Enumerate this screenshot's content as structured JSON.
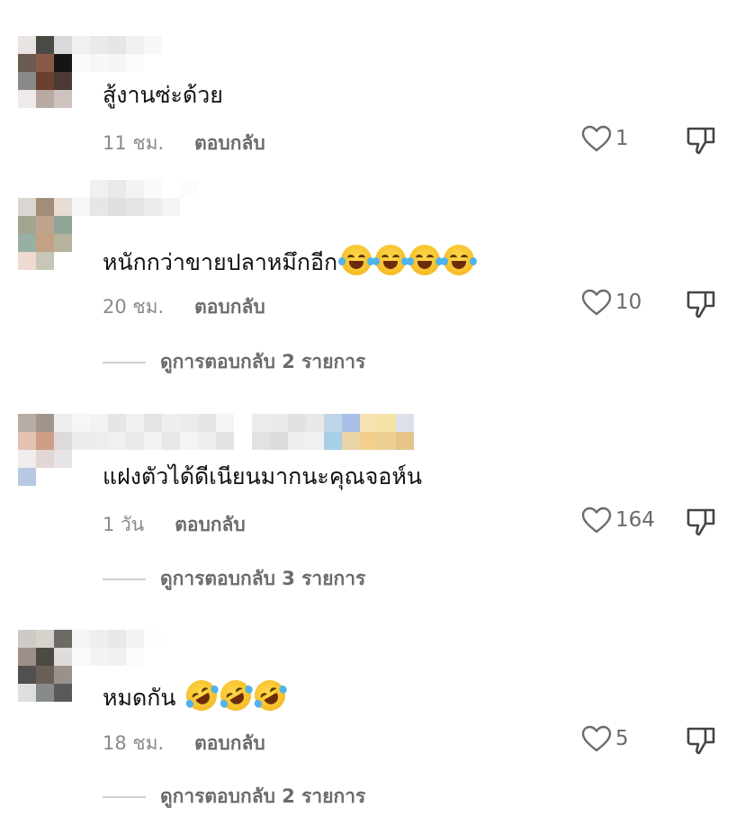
{
  "comments": [
    {
      "text": "สู้งานซ่ะด้วย",
      "time": "11 ชม.",
      "reply_label": "ตอบกลับ",
      "likes": "1",
      "emoji_count": 0,
      "view_replies": ""
    },
    {
      "text": "หนักกว่าขายปลาหมึกอีก",
      "time": "20 ชม.",
      "reply_label": "ตอบกลับ",
      "likes": "10",
      "emoji": "face-with-tears-of-joy",
      "emoji_count": 4,
      "view_replies": "ดูการตอบกลับ 2 รายการ"
    },
    {
      "text": "แฝงตัวได้ดีเนียนมากนะคุณจอห์น",
      "time": "1 วัน",
      "reply_label": "ตอบกลับ",
      "likes": "164",
      "emoji_count": 0,
      "view_replies": "ดูการตอบกลับ 3 รายการ"
    },
    {
      "text": "หมดกัน",
      "time": "18 ชม.",
      "reply_label": "ตอบกลับ",
      "likes": "5",
      "emoji": "rolling-on-floor-laughing",
      "emoji_count": 3,
      "view_replies": "ดูการตอบกลับ 2 รายการ"
    }
  ],
  "colors": {
    "text": "#111111",
    "meta": "#8a8a8a",
    "action": "#6b6b6b",
    "divider": "#cfcfcf"
  }
}
